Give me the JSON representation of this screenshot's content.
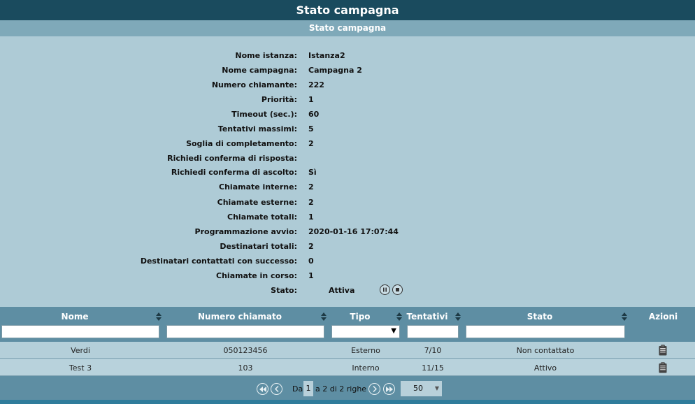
{
  "window": {
    "title": "Stato campagna"
  },
  "section": {
    "title": "Stato campagna"
  },
  "details": [
    {
      "label": "Nome istanza:",
      "value": "Istanza2"
    },
    {
      "label": "Nome campagna:",
      "value": "Campagna 2"
    },
    {
      "label": "Numero chiamante:",
      "value": "222"
    },
    {
      "label": "Priorità:",
      "value": "1"
    },
    {
      "label": "Timeout (sec.):",
      "value": "60"
    },
    {
      "label": "Tentativi massimi:",
      "value": "5"
    },
    {
      "label": "Soglia di completamento:",
      "value": "2"
    },
    {
      "label": "Richiedi conferma di risposta:",
      "value": ""
    },
    {
      "label": "Richiedi conferma di ascolto:",
      "value": "Sì"
    },
    {
      "label": "Chiamate interne:",
      "value": "2"
    },
    {
      "label": "Chiamate esterne:",
      "value": "2"
    },
    {
      "label": "Chiamate totali:",
      "value": "1"
    },
    {
      "label": "Programmazione avvio:",
      "value": "2020-01-16 17:07:44"
    },
    {
      "label": "Destinatari totali:",
      "value": "2"
    },
    {
      "label": "Destinatari contattati con successo:",
      "value": "0"
    },
    {
      "label": "Chiamate in corso:",
      "value": "1"
    }
  ],
  "status": {
    "label": "Stato:",
    "value": "Attiva",
    "pause_icon": "pause-icon",
    "stop_icon": "stop-icon"
  },
  "table": {
    "columns": [
      "Nome",
      "Numero chiamato",
      "Tipo",
      "Tentativi",
      "Stato",
      "Azioni"
    ],
    "rows": [
      {
        "nome": "Verdi",
        "numero": "050123456",
        "tipo": "Esterno",
        "tentativi": "7/10",
        "stato": "Non contattato",
        "azione_icon": "clipboard-icon"
      },
      {
        "nome": "Test 3",
        "numero": "103",
        "tipo": "Interno",
        "tentativi": "11/15",
        "stato": "Attivo",
        "azione_icon": "clipboard-icon"
      }
    ]
  },
  "pager": {
    "prefix": "Da",
    "page": "1",
    "suffix": "a 2 di 2 righe",
    "page_size": "50"
  },
  "colors": {
    "header": "#1a4b5e",
    "subheader": "#7fa9b9",
    "panel": "#aecbd6",
    "grid_header": "#5e8ea3"
  }
}
